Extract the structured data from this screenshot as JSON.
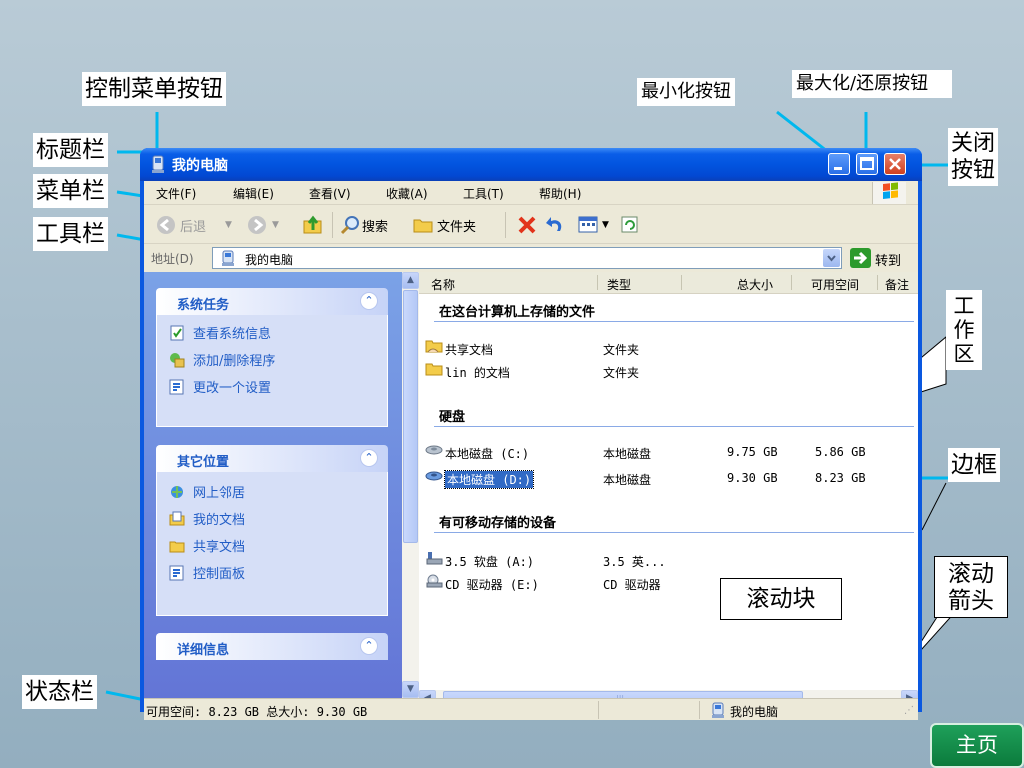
{
  "window": {
    "title": "我的电脑",
    "menu": [
      "文件(F)",
      "编辑(E)",
      "查看(V)",
      "收藏(A)",
      "工具(T)",
      "帮助(H)"
    ],
    "toolbar": {
      "back": "后退",
      "search": "搜索",
      "folders": "文件夹"
    },
    "address": {
      "label": "地址(D)",
      "value": "我的电脑",
      "go": "转到"
    },
    "left_panels": [
      {
        "title": "系统任务",
        "items": [
          "查看系统信息",
          "添加/删除程序",
          "更改一个设置"
        ]
      },
      {
        "title": "其它位置",
        "items": [
          "网上邻居",
          "我的文档",
          "共享文档",
          "控制面板"
        ]
      },
      {
        "title": "详细信息",
        "items": []
      }
    ],
    "columns": [
      "名称",
      "类型",
      "总大小",
      "可用空间",
      "备注"
    ],
    "groups": [
      {
        "title": "在这台计算机上存储的文件",
        "items": [
          {
            "name": "共享文档",
            "type": "文件夹",
            "size": "",
            "free": ""
          },
          {
            "name": "lin 的文档",
            "type": "文件夹",
            "size": "",
            "free": ""
          }
        ]
      },
      {
        "title": "硬盘",
        "items": [
          {
            "name": "本地磁盘 (C:)",
            "type": "本地磁盘",
            "size": "9.75 GB",
            "free": "5.86 GB"
          },
          {
            "name": "本地磁盘 (D:)",
            "type": "本地磁盘",
            "size": "9.30 GB",
            "free": "8.23 GB"
          }
        ]
      },
      {
        "title": "有可移动存储的设备",
        "items": [
          {
            "name": "3.5 软盘 (A:)",
            "type": "3.5 英...",
            "size": "",
            "free": ""
          },
          {
            "name": "CD 驱动器 (E:)",
            "type": "CD 驱动器",
            "size": "",
            "free": ""
          }
        ]
      }
    ],
    "status": {
      "left": "可用空间: 8.23 GB 总大小: 9.30 GB",
      "right": "我的电脑"
    }
  },
  "callouts": {
    "control_menu": "控制菜单按钮",
    "title_bar": "标题栏",
    "menu_bar": "菜单栏",
    "tool_bar": "工具栏",
    "minimize": "最小化按钮",
    "maximize": "最大化/还原按钮",
    "close": "关闭按钮",
    "close_line1": "关闭",
    "close_line2": "按钮",
    "work_area": "工作区",
    "work_area_chars": [
      "工",
      "作",
      "区"
    ],
    "border": "边框",
    "scroll_thumb": "滚动块",
    "scroll_arrow": "滚动箭头",
    "scroll_arrow_line1": "滚动",
    "scroll_arrow_line2": "箭头",
    "status_bar": "状态栏"
  },
  "home_button": "主页"
}
